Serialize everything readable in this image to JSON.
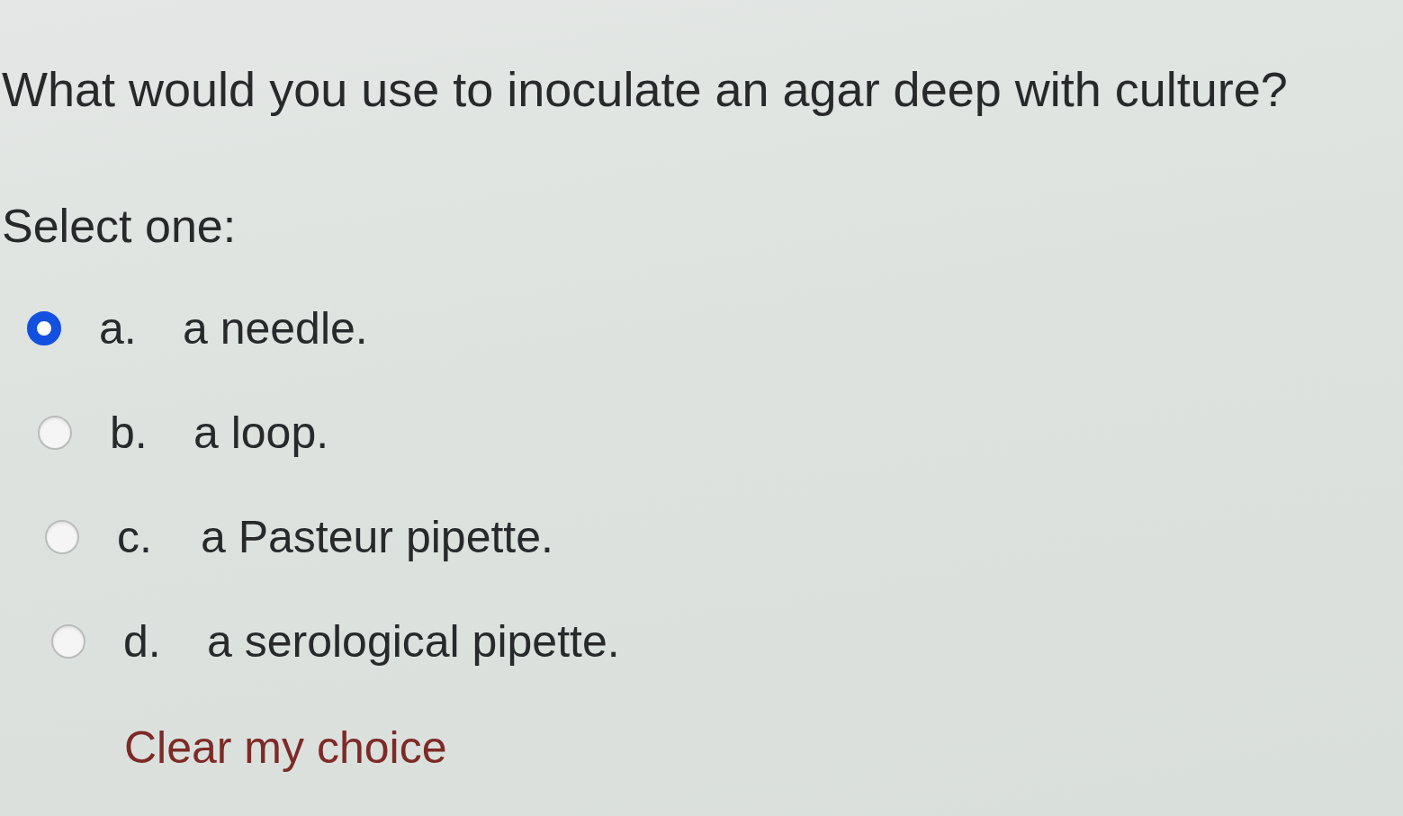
{
  "question": "What would you use to inoculate an agar deep with culture?",
  "prompt": "Select one:",
  "options": [
    {
      "letter": "a.",
      "text": "a needle.",
      "selected": true
    },
    {
      "letter": "b.",
      "text": "a loop.",
      "selected": false
    },
    {
      "letter": "c.",
      "text": "a Pasteur pipette.",
      "selected": false
    },
    {
      "letter": "d.",
      "text": "a serological pipette.",
      "selected": false
    }
  ],
  "clear_link": "Clear my choice"
}
